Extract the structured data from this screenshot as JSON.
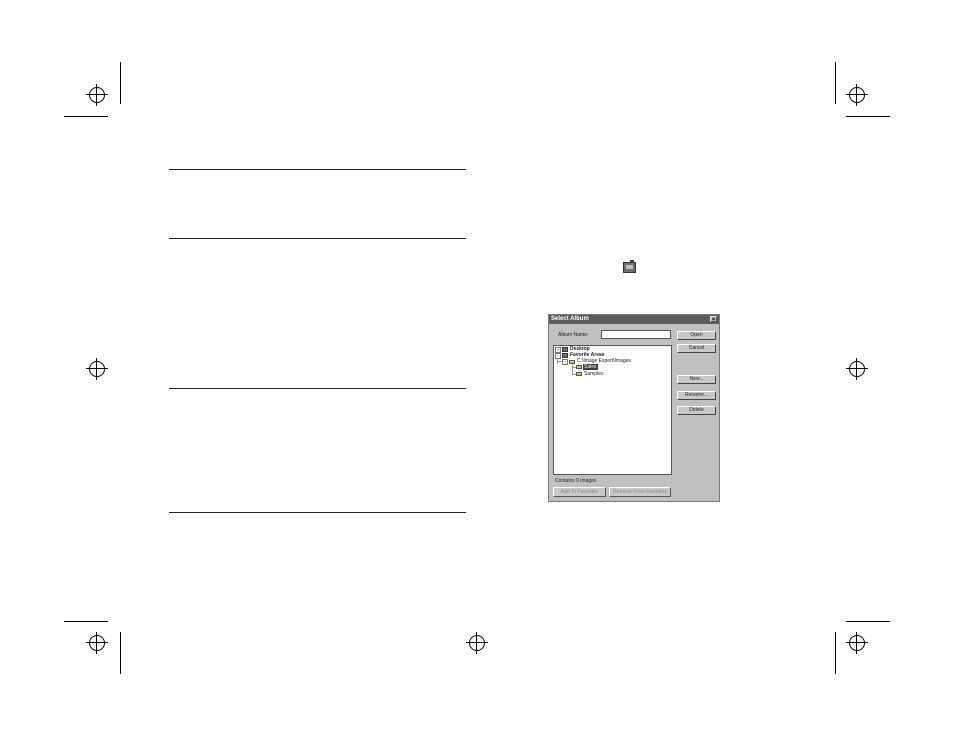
{
  "dialog": {
    "title": "Select Album",
    "album_name_label": "Album Name:",
    "album_name_value": "",
    "buttons": {
      "open": "Open",
      "cancel": "Cancel",
      "new": "New...",
      "rename": "Rename...",
      "delete": "Delete"
    },
    "tree": {
      "desktop": "Desktop",
      "favorite_areas": "Favorite Areas",
      "path": "C:\\Image Expert\\Images",
      "selected_item": "Sales",
      "samples": "Samples"
    },
    "status": "Contains 0 images",
    "add_favorites": "Add To Favorites",
    "remove_favorites": "Remove From Favorites"
  },
  "icons": [
    "album-icon",
    "close-icon",
    "folder-icon",
    "desktop-icon",
    "expand-icon"
  ]
}
